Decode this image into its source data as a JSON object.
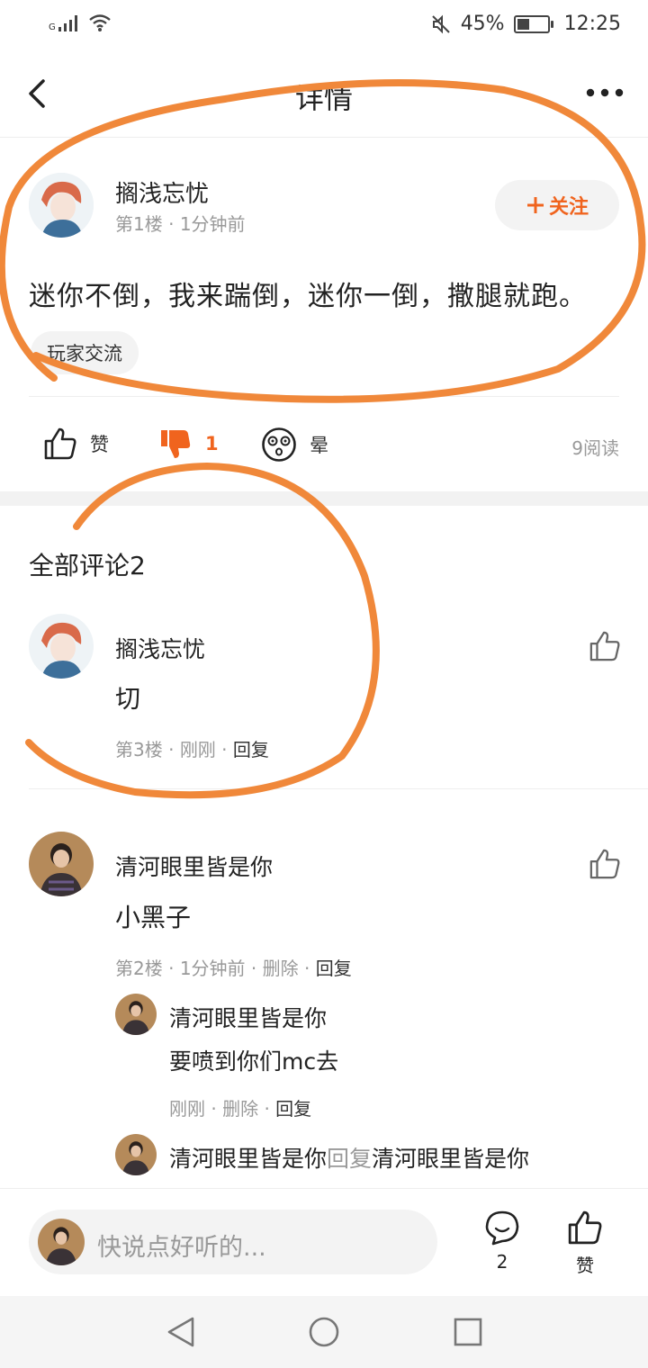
{
  "status_bar": {
    "signal_label": "G",
    "battery_percent": "45%",
    "battery_level": 0.45,
    "time": "12:25"
  },
  "header": {
    "title": "详情"
  },
  "post": {
    "author": "搁浅忘忧",
    "floor": "第1楼",
    "time": "1分钟前",
    "follow_label": "关注",
    "content": "迷你不倒，我来踹倒，迷你一倒，撒腿就跑。",
    "tag": "玩家交流",
    "actions": {
      "like_label": "赞",
      "dislike_count": "1",
      "dizzy_label": "晕"
    },
    "read_count": "9阅读"
  },
  "comments": {
    "title": "全部评论2",
    "items": [
      {
        "name": "搁浅忘忧",
        "text": "切",
        "floor": "第3楼",
        "time": "刚刚",
        "reply_label": "回复"
      },
      {
        "name": "清河眼里皆是你",
        "text": "小黑子",
        "floor": "第2楼",
        "time": "1分钟前",
        "delete_label": "删除",
        "reply_label": "回复",
        "replies": [
          {
            "name": "清河眼里皆是你",
            "text": "要喷到你们mc去",
            "time": "刚刚",
            "delete_label": "删除",
            "reply_label": "回复"
          },
          {
            "name": "清河眼里皆是你",
            "reply_word": "回复",
            "target": "清河眼里皆是你"
          }
        ]
      }
    ]
  },
  "bottom_bar": {
    "input_placeholder": "快说点好听的...",
    "comment_count": "2",
    "like_label": "赞"
  },
  "colors": {
    "accent": "#f0641e",
    "annotation": "#f0883a"
  }
}
